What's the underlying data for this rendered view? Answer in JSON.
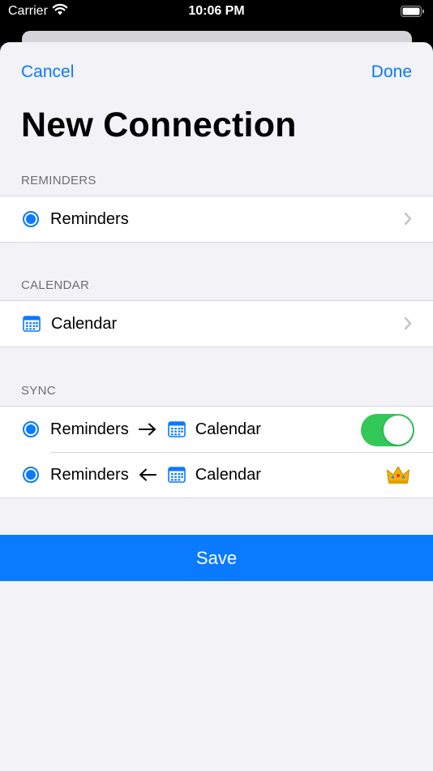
{
  "status_bar": {
    "carrier": "Carrier",
    "time": "10:06 PM"
  },
  "nav": {
    "cancel": "Cancel",
    "done": "Done"
  },
  "title": "New Connection",
  "sections": {
    "reminders": {
      "header": "REMINDERS",
      "item_label": "Reminders"
    },
    "calendar": {
      "header": "CALENDAR",
      "item_label": "Calendar"
    },
    "sync": {
      "header": "SYNC",
      "rows": [
        {
          "from": "Reminders",
          "to": "Calendar",
          "direction": "→",
          "toggle_on": true
        },
        {
          "from": "Reminders",
          "to": "Calendar",
          "direction": "←",
          "premium": true
        }
      ]
    }
  },
  "save_label": "Save",
  "colors": {
    "accent": "#0a7aff",
    "toggle_on": "#34c759",
    "background": "#f2f2f7"
  },
  "icons": {
    "source": "radio-icon",
    "calendar": "calendar-icon",
    "premium": "crown-icon"
  }
}
